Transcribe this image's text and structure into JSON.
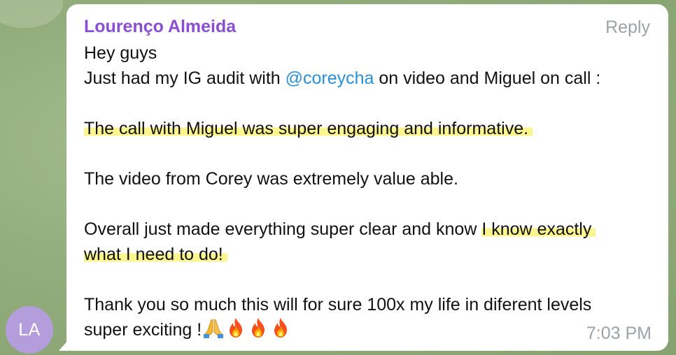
{
  "avatar": {
    "initials": "LA",
    "color": "#b39ddb"
  },
  "message": {
    "sender": "Lourenço Almeida",
    "sender_color": "#8a4fd1",
    "reply_label": "Reply",
    "greeting": "Hey guys",
    "line2_before": "Just had my IG audit with ",
    "mention": "@coreycha",
    "line2_after": " on video and Miguel on call :",
    "highlight1": "The call with Miguel was super engaging and informative.",
    "line_video": "The video from Corey was extremely value able.",
    "line_overall_before": "Overall just made everything super clear and know ",
    "highlight2_part1": "I know exactly",
    "highlight2_part2": "what I need to do!",
    "line_thanks": "Thank you so much this will for sure 100x my life in diferent levels",
    "line_exciting": "super exciting !",
    "emojis": [
      "folded-hands",
      "fire",
      "fire",
      "fire"
    ],
    "time": "7:03 PM",
    "highlight_color": "#fbf58f",
    "mention_color": "#2a8fd6"
  }
}
